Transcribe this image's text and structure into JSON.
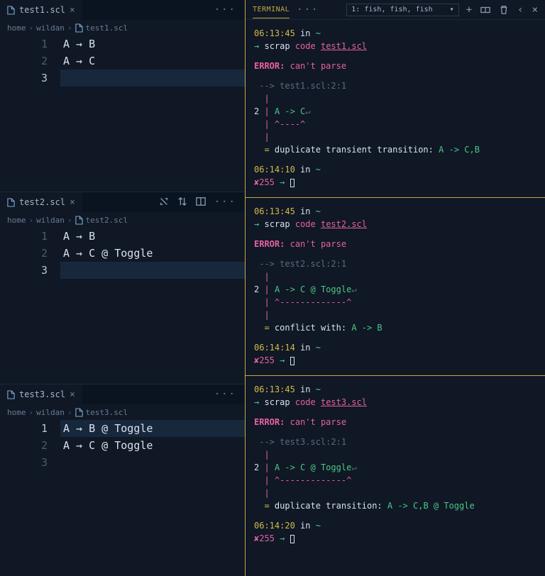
{
  "editors": [
    {
      "tab": "test1.scl",
      "breadcrumb": [
        "home",
        "wildan",
        "test1.scl"
      ],
      "lines": [
        "A → B",
        "A → C",
        ""
      ],
      "activeLine": 2
    },
    {
      "tab": "test2.scl",
      "breadcrumb": [
        "home",
        "wildan",
        "test2.scl"
      ],
      "lines": [
        "A → B",
        "A → C @ Toggle",
        ""
      ],
      "activeLine": 2
    },
    {
      "tab": "test3.scl",
      "breadcrumb": [
        "home",
        "wildan",
        "test3.scl"
      ],
      "lines": [
        "A → B @ Toggle",
        "A → C @ Toggle",
        ""
      ],
      "activeLine": 0
    }
  ],
  "terminal": {
    "tabLabel": "TERMINAL",
    "dropdown": "1: fish, fish, fish",
    "blocks": [
      {
        "time1": "06:13:45",
        "in": "in",
        "cwd": "~",
        "cmd": "scrap",
        "sub": "code",
        "file": "test1.scl",
        "error": "ERROR:",
        "errorMsg": "can't parse",
        "loc": "--> test1.scl:2:1",
        "lineNo": "2",
        "code": "A -> C",
        "underline": "^----^",
        "note": "duplicate transient transition:",
        "noteCode": "A -> C,B",
        "time2": "06:14:10",
        "exit": "✘255"
      },
      {
        "time1": "06:13:45",
        "in": "in",
        "cwd": "~",
        "cmd": "scrap",
        "sub": "code",
        "file": "test2.scl",
        "error": "ERROR:",
        "errorMsg": "can't parse",
        "loc": "--> test2.scl:2:1",
        "lineNo": "2",
        "code": "A -> C @ Toggle",
        "underline": "^-------------^",
        "note": "conflict with:",
        "noteCode": "A -> B",
        "time2": "06:14:14",
        "exit": "✘255"
      },
      {
        "time1": "06:13:45",
        "in": "in",
        "cwd": "~",
        "cmd": "scrap",
        "sub": "code",
        "file": "test3.scl",
        "error": "ERROR:",
        "errorMsg": "can't parse",
        "loc": "--> test3.scl:2:1",
        "lineNo": "2",
        "code": "A -> C @ Toggle",
        "underline": "^-------------^",
        "note": "duplicate transition:",
        "noteCode": "A -> C,B @ Toggle",
        "time2": "06:14:20",
        "exit": "✘255"
      }
    ]
  }
}
